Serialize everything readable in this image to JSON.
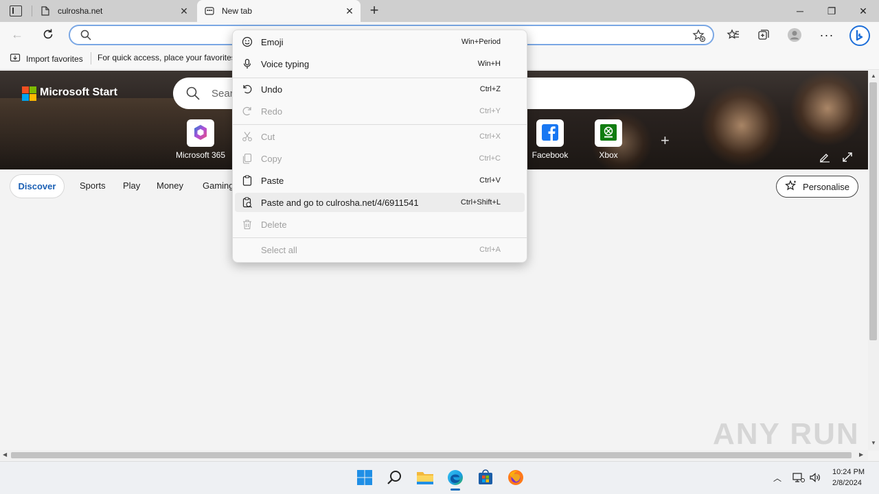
{
  "browser": {
    "tabs": [
      {
        "title": "culrosha.net",
        "icon": "page-icon"
      },
      {
        "title": "New tab",
        "icon": "newtab-page-icon"
      }
    ],
    "window_controls": [
      "minimize-icon",
      "restore-icon",
      "close-icon"
    ]
  },
  "favorites_bar": {
    "import_label": "Import favorites",
    "hint": "For quick access, place your favorites"
  },
  "newtab": {
    "brand": "Microsoft Start",
    "search_placeholder": "Search",
    "tiles": [
      {
        "label": "Microsoft 365",
        "icon": "microsoft365-icon"
      },
      {
        "label": "Facebook",
        "icon": "facebook-icon",
        "color": "#1877f2"
      },
      {
        "label": "Xbox",
        "icon": "xbox-icon",
        "color": "#107c10"
      }
    ],
    "nav": [
      "Discover",
      "Sports",
      "Play",
      "Money",
      "Gaming"
    ],
    "personalise_label": "Personalise"
  },
  "context_menu": {
    "items": [
      {
        "label": "Emoji",
        "shortcut": "Win+Period",
        "icon": "emoji-icon",
        "enabled": true
      },
      {
        "label": "Voice typing",
        "shortcut": "Win+H",
        "icon": "microphone-icon",
        "enabled": true
      },
      {
        "label": "Undo",
        "shortcut": "Ctrl+Z",
        "icon": "undo-icon",
        "enabled": true
      },
      {
        "label": "Redo",
        "shortcut": "Ctrl+Y",
        "icon": "redo-icon",
        "enabled": false
      },
      {
        "label": "Cut",
        "shortcut": "Ctrl+X",
        "icon": "scissors-icon",
        "enabled": false
      },
      {
        "label": "Copy",
        "shortcut": "Ctrl+C",
        "icon": "copy-icon",
        "enabled": false
      },
      {
        "label": "Paste",
        "shortcut": "Ctrl+V",
        "icon": "paste-icon",
        "enabled": true
      },
      {
        "label": "Paste and go to culrosha.net/4/6911541",
        "shortcut": "Ctrl+Shift+L",
        "icon": "paste-go-icon",
        "enabled": true
      },
      {
        "label": "Delete",
        "shortcut": "",
        "icon": "trash-icon",
        "enabled": false
      },
      {
        "label": "Select all",
        "shortcut": "Ctrl+A",
        "icon": "",
        "enabled": false
      }
    ]
  },
  "watermark": "ANY RUN",
  "taskbar": {
    "apps": [
      "windows-start-icon",
      "search-icon",
      "file-explorer-icon",
      "edge-icon",
      "store-icon",
      "firefox-icon"
    ],
    "time": "10:24 PM",
    "date": "2/8/2024"
  },
  "colors": {
    "accent": "#0f6cbd",
    "address_focus": "#7aa7e4"
  }
}
